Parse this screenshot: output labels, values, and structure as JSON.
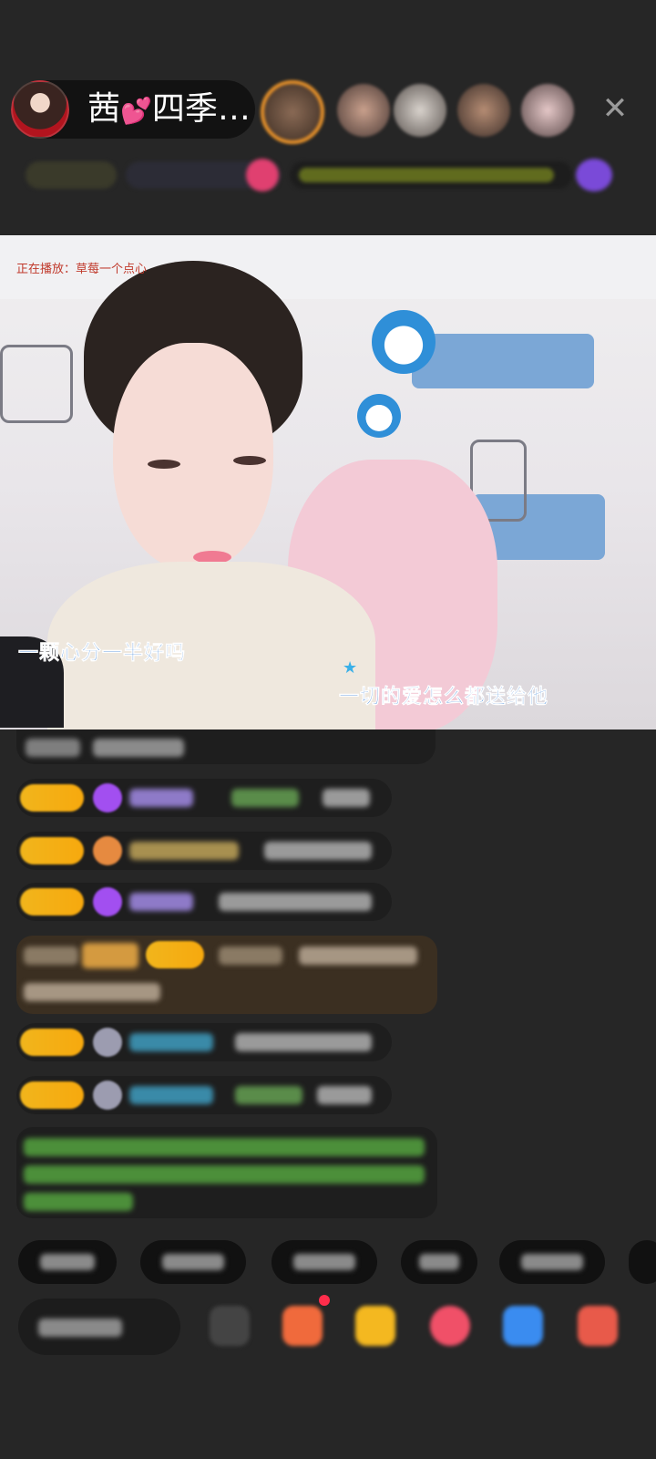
{
  "header": {
    "host_name": "茜",
    "host_name_suffix": "四季…",
    "heart_icon": "heart-icon",
    "close_icon": "close-icon",
    "viewer_count": 5
  },
  "video": {
    "now_playing": "正在播放：草莓一个点心",
    "lyric_line_1": "一颗心分一半好吗",
    "lyric_line_2": "一切的爱怎么都送给他",
    "star_icon": "star-icon"
  },
  "chat": {
    "messages_visible": 7,
    "accent_colors": {
      "badge": "#f1b51c",
      "gift_purple": "#a24ff0",
      "highlight_bg": "#3b2f21",
      "note_text": "#4c8f3a"
    }
  },
  "quick_replies": {
    "count": 5
  },
  "bottom_bar": {
    "icons": [
      "chat-icon",
      "gift-box-icon",
      "treasure-icon",
      "red-envelope-icon",
      "game-icon",
      "more-icon"
    ]
  }
}
